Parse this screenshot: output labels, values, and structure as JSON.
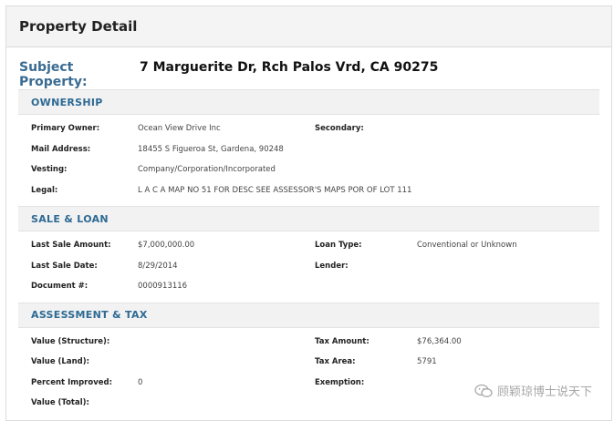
{
  "header": {
    "title": "Property Detail"
  },
  "subject": {
    "label": "Subject Property:",
    "address": "7 Marguerite Dr, Rch Palos Vrd, CA 90275"
  },
  "ownership": {
    "title": "OWNERSHIP",
    "primary_owner_label": "Primary Owner:",
    "primary_owner": "Ocean View Drive Inc",
    "secondary_label": "Secondary:",
    "secondary": "",
    "mail_address_label": "Mail Address:",
    "mail_address": "18455 S Figueroa St, Gardena, 90248",
    "vesting_label": "Vesting:",
    "vesting": "Company/Corporation/Incorporated",
    "legal_label": "Legal:",
    "legal": "L A C A MAP NO 51 FOR DESC SEE ASSESSOR'S MAPS POR OF LOT 111"
  },
  "sale_loan": {
    "title": "SALE & LOAN",
    "last_sale_amount_label": "Last Sale Amount:",
    "last_sale_amount": "$7,000,000.00",
    "loan_type_label": "Loan Type:",
    "loan_type": "Conventional or Unknown",
    "last_sale_date_label": "Last Sale Date:",
    "last_sale_date": "8/29/2014",
    "lender_label": "Lender:",
    "lender": "",
    "document_label": "Document #:",
    "document": "0000913116"
  },
  "assessment": {
    "title": "ASSESSMENT & TAX",
    "value_structure_label": "Value (Structure):",
    "value_structure": "",
    "tax_amount_label": "Tax Amount:",
    "tax_amount": "$76,364.00",
    "value_land_label": "Value (Land):",
    "value_land": "",
    "tax_area_label": "Tax Area:",
    "tax_area": "5791",
    "percent_improved_label": "Percent Improved:",
    "percent_improved": "0",
    "exemption_label": "Exemption:",
    "exemption": "",
    "value_total_label": "Value (Total):",
    "value_total": ""
  },
  "watermark": {
    "text": "顾颖琼博士说天下",
    "icon": "wechat-icon"
  }
}
